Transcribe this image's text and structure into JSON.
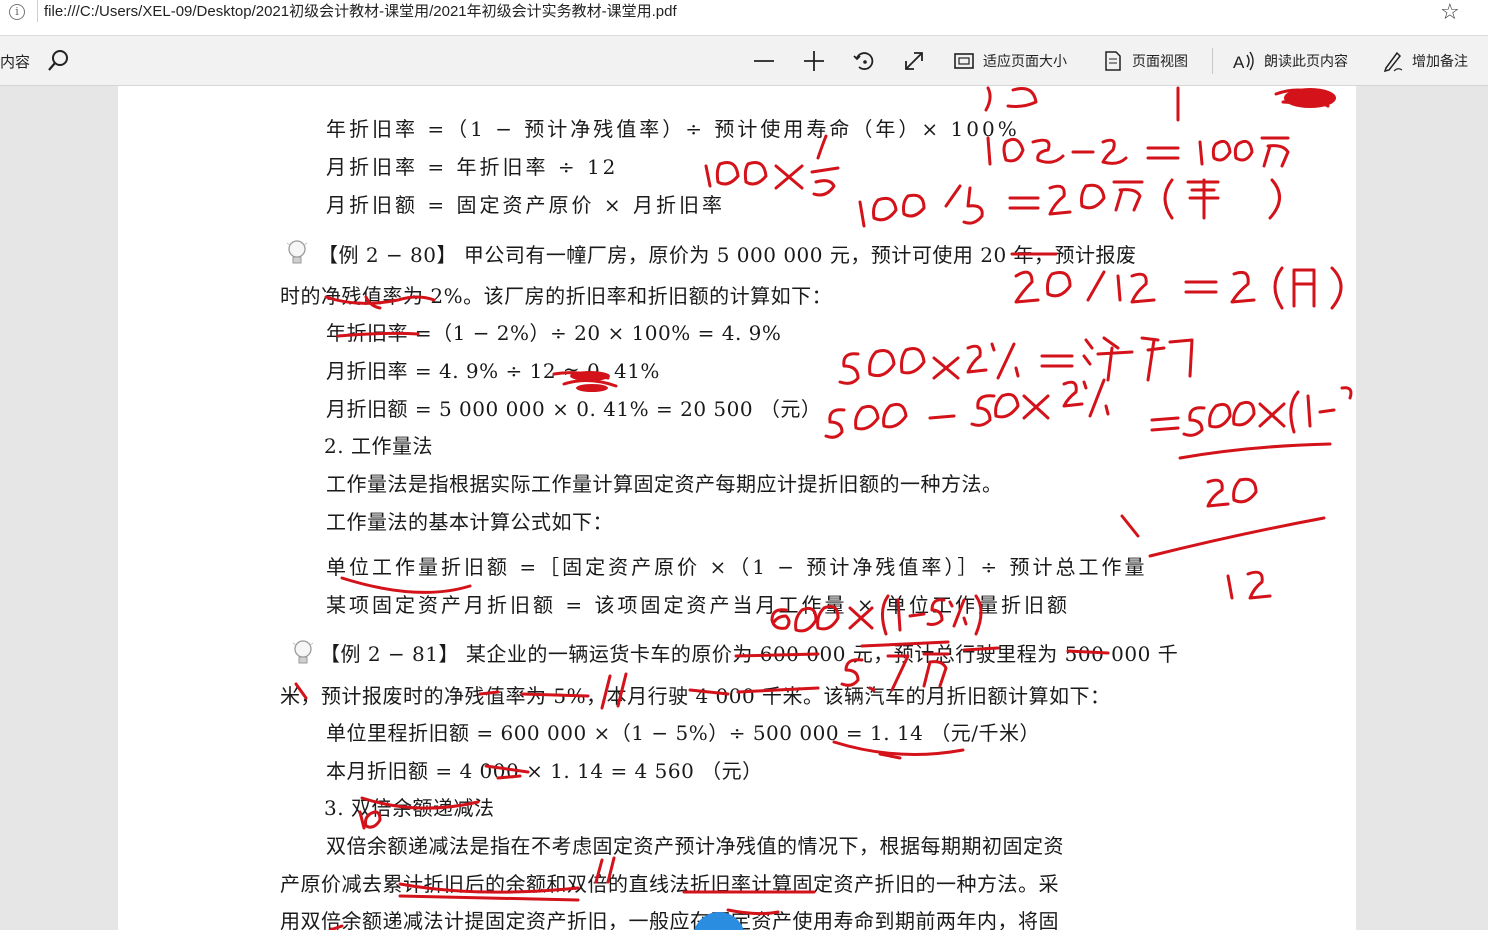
{
  "address_bar": {
    "url": "file:///C:/Users/XEL-09/Desktop/2021初级会计教材-课堂用/2021年初级会计实务教材-课堂用.pdf",
    "info_icon": "info-icon",
    "favorite_icon": "star-icon"
  },
  "toolbar": {
    "left_label": "内容",
    "fit_page": "适应页面大小",
    "page_view": "页面视图",
    "read_aloud": "朗读此页内容",
    "add_note": "增加备注"
  },
  "page": {
    "lines": [
      "年折旧率 =（1 − 预计净残值率）÷ 预计使用寿命（年）× 100%",
      "月折旧率 = 年折旧率 ÷ 12",
      "月折旧额 = 固定资产原价 × 月折旧率",
      "【例 2 − 80】 甲公司有一幢厂房，原价为 5 000 000 元，预计可使用 20 年，预计报废",
      "时的净残值率为 2%。该厂房的折旧率和折旧额的计算如下：",
      "年折旧率 =（1 − 2%）÷ 20 × 100% = 4. 9%",
      "月折旧率 = 4. 9% ÷ 12 ≈ 0. 41%",
      "月折旧额 = 5 000 000 × 0. 41% = 20 500 （元）",
      "2. 工作量法",
      "工作量法是指根据实际工作量计算固定资产每期应计提折旧额的一种方法。",
      "工作量法的基本计算公式如下：",
      "单位工作量折旧额 =［固定资产原价 ×（1 − 预计净残值率）］÷ 预计总工作量",
      "某项固定资产月折旧额 = 该项固定资产当月工作量 × 单位工作量折旧额",
      "【例 2 − 81】 某企业的一辆运货卡车的原价为 600 000 元，预计总行驶里程为 500 000 千",
      "米，预计报废时的净残值率为 5%，本月行驶 4 000 千米。该辆汽车的月折旧额计算如下：",
      "单位里程折旧额 = 600 000 ×（1 − 5%）÷ 500 000 = 1. 14 （元/千米）",
      "本月折旧额 = 4 000 × 1. 14 = 4 560 （元）",
      "3. 双倍余额递减法",
      "双倍余额递减法是指在不考虑固定资产预计净残值的情况下，根据每期期初固定资",
      "产原价减去累计折旧后的余额和双倍的直线法折旧率计算固定资产折旧的一种方法。采",
      "用双倍余额递减法计提固定资产折旧，一般应在固定资产使用寿命到期前两年内，将固"
    ]
  },
  "colors": {
    "ink": "#d3121a",
    "page": "#ffffff",
    "chrome": "#f2f2f2"
  }
}
